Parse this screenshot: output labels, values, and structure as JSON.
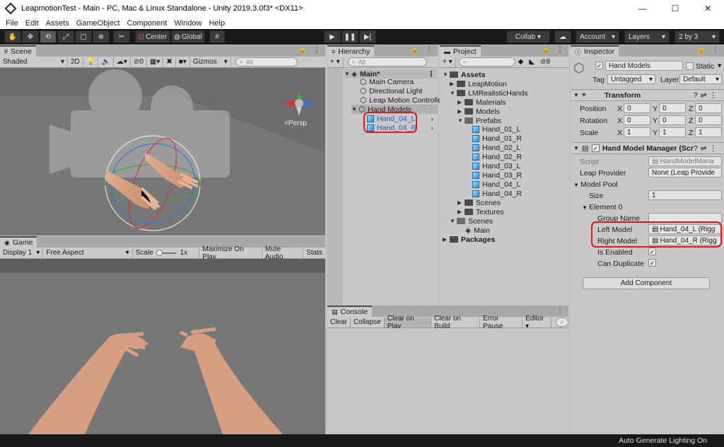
{
  "window": {
    "title": "LeapmotionTest - Main - PC, Mac & Linux Standalone - Unity 2019.3.0f3* <DX11>",
    "min": "—",
    "max": "☐",
    "close": "✕"
  },
  "menu": [
    "File",
    "Edit",
    "Assets",
    "GameObject",
    "Component",
    "Window",
    "Help"
  ],
  "toolbar": {
    "center": "Center",
    "global": "Global",
    "collab": "Collab ▾",
    "account": "Account",
    "layers": "Layers",
    "layout": "2 by 3"
  },
  "scene": {
    "tab": "Scene",
    "shaded": "Shaded",
    "mode2d": "2D",
    "fx_count": "0",
    "gizmos": "Gizmos",
    "search_placeholder": "All",
    "persp": "<Persp"
  },
  "game": {
    "tab": "Game",
    "display": "Display 1",
    "aspect": "Free Aspect",
    "scale_label": "Scale",
    "scale_value": "1x",
    "maximize": "Maximize On Play",
    "mute": "Mute Audio",
    "stats": "Stats"
  },
  "hierarchy": {
    "tab": "Hierarchy",
    "search_placeholder": "All",
    "scene_name": "Main*",
    "items": [
      "Main Camera",
      "Directional Light",
      "Leap Motion Controlle",
      "Hand Models"
    ],
    "children": [
      "Hand_04_L",
      "Hand_04_R"
    ]
  },
  "project": {
    "tab": "Project",
    "badge": "8",
    "assets": "Assets",
    "leapmotion": "LeapMotion",
    "lmrealistic": "LMRealisticHands",
    "materials": "Materials",
    "models": "Models",
    "prefabs": "Prefabs",
    "prefab_items": [
      "Hand_01_L",
      "Hand_01_R",
      "Hand_02_L",
      "Hand_02_R",
      "Hand_03_L",
      "Hand_03_R",
      "Hand_04_L",
      "Hand_04_R"
    ],
    "scenes": "Scenes",
    "textures": "Textures",
    "scenes2": "Scenes",
    "main": "Main",
    "packages": "Packages"
  },
  "console": {
    "tab": "Console",
    "buttons": [
      "Clear",
      "Collapse",
      "Clear on Play",
      "Clear on Build",
      "Error Pause",
      "Editor ▾"
    ]
  },
  "inspector": {
    "tab": "Inspector",
    "name": "Hand Models",
    "static": "Static",
    "tag_label": "Tag",
    "tag_value": "Untagged",
    "layer_label": "Layer",
    "layer_value": "Default",
    "transform": "Transform",
    "position": "Position",
    "rotation": "Rotation",
    "scale": "Scale",
    "axis_x": "X",
    "axis_y": "Y",
    "axis_z": "Z",
    "pos": [
      "0",
      "0",
      "0"
    ],
    "rot": [
      "0",
      "0",
      "0"
    ],
    "scl": [
      "1",
      "1",
      "1"
    ],
    "manager": "Hand Model Manager (Scr",
    "script_label": "Script",
    "script_value": "HandModelMana",
    "leap_provider_label": "Leap Provider",
    "leap_provider_value": "None (Leap Provide",
    "model_pool": "Model Pool",
    "size_label": "Size",
    "size_value": "1",
    "element0": "Element 0",
    "group_name": "Group Name",
    "left_model": "Left Model",
    "left_value": "Hand_04_L (Rigg",
    "right_model": "Right Model",
    "right_value": "Hand_04_R (Rigg",
    "is_enabled": "Is Enabled",
    "can_duplicate": "Can Duplicate",
    "add_component": "Add Component"
  },
  "status": "Auto Generate Lighting On"
}
